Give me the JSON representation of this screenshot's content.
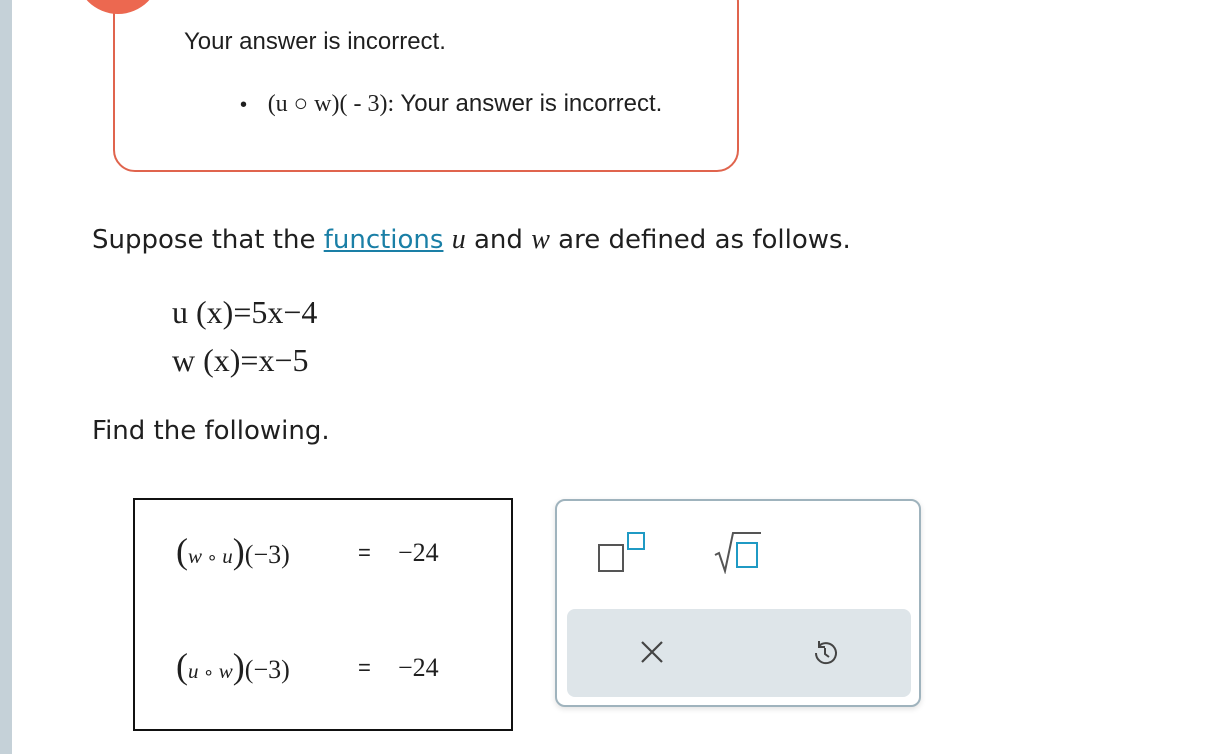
{
  "feedback": {
    "title": "Your answer is incorrect.",
    "item_bullet": "•",
    "item_math": "(u ○ w)( - 3):",
    "item_text": "Your answer is incorrect."
  },
  "problem": {
    "intro_before": "Suppose that the ",
    "link": "functions",
    "var_u": "u",
    "and": " and ",
    "var_w": "w",
    "intro_after": " are defined as follows.",
    "def_u": "u (x)=5x−4",
    "def_w": "w (x)=x−5",
    "find": "Find the following."
  },
  "answers": [
    {
      "lhs_open": "(",
      "lhs_f": "w",
      "lhs_op": " ∘ ",
      "lhs_g": "u",
      "lhs_close": ")",
      "lhs_arg": "(−3)",
      "eq": "=",
      "value": "−24"
    },
    {
      "lhs_open": "(",
      "lhs_f": "u",
      "lhs_op": " ∘ ",
      "lhs_g": "w",
      "lhs_close": ")",
      "lhs_arg": "(−3)",
      "eq": "=",
      "value": "−24"
    }
  ],
  "toolbox": {
    "superscript_icon": "superscript-icon",
    "sqrt_icon": "square-root-icon",
    "clear_icon": "close-icon",
    "clear_glyph": "✕",
    "undo_icon": "undo-icon",
    "accent": "#1f9ac4",
    "panel_bg": "#dee5e9"
  }
}
